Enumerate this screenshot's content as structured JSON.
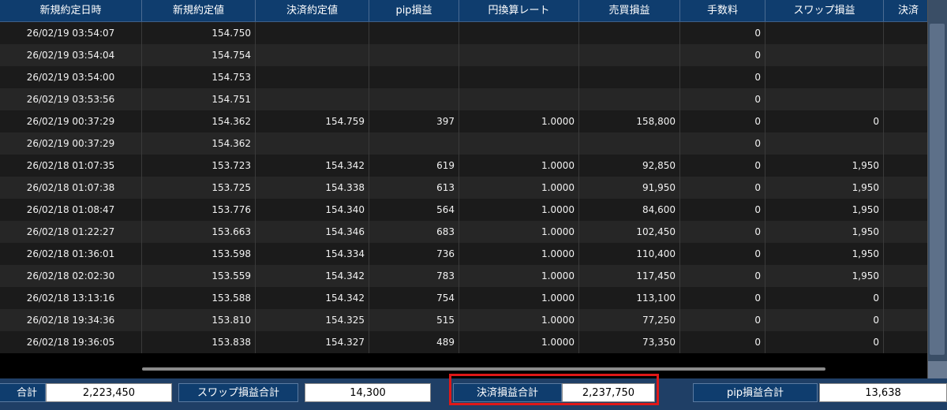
{
  "columns": [
    "新規約定日時",
    "新規約定値",
    "決済約定値",
    "pip損益",
    "円換算レート",
    "売買損益",
    "手数料",
    "スワップ損益",
    "決済"
  ],
  "rows": [
    {
      "date": "26/02/19 03:54:07",
      "open": "154.750",
      "close": "",
      "pip": "",
      "rate": "",
      "pl": "",
      "fee": "0",
      "swap": ""
    },
    {
      "date": "26/02/19 03:54:04",
      "open": "154.754",
      "close": "",
      "pip": "",
      "rate": "",
      "pl": "",
      "fee": "0",
      "swap": ""
    },
    {
      "date": "26/02/19 03:54:00",
      "open": "154.753",
      "close": "",
      "pip": "",
      "rate": "",
      "pl": "",
      "fee": "0",
      "swap": ""
    },
    {
      "date": "26/02/19 03:53:56",
      "open": "154.751",
      "close": "",
      "pip": "",
      "rate": "",
      "pl": "",
      "fee": "0",
      "swap": ""
    },
    {
      "date": "26/02/19 00:37:29",
      "open": "154.362",
      "close": "154.759",
      "pip": "397",
      "rate": "1.0000",
      "pl": "158,800",
      "fee": "0",
      "swap": "0"
    },
    {
      "date": "26/02/19 00:37:29",
      "open": "154.362",
      "close": "",
      "pip": "",
      "rate": "",
      "pl": "",
      "fee": "0",
      "swap": ""
    },
    {
      "date": "26/02/18 01:07:35",
      "open": "153.723",
      "close": "154.342",
      "pip": "619",
      "rate": "1.0000",
      "pl": "92,850",
      "fee": "0",
      "swap": "1,950"
    },
    {
      "date": "26/02/18 01:07:38",
      "open": "153.725",
      "close": "154.338",
      "pip": "613",
      "rate": "1.0000",
      "pl": "91,950",
      "fee": "0",
      "swap": "1,950"
    },
    {
      "date": "26/02/18 01:08:47",
      "open": "153.776",
      "close": "154.340",
      "pip": "564",
      "rate": "1.0000",
      "pl": "84,600",
      "fee": "0",
      "swap": "1,950"
    },
    {
      "date": "26/02/18 01:22:27",
      "open": "153.663",
      "close": "154.346",
      "pip": "683",
      "rate": "1.0000",
      "pl": "102,450",
      "fee": "0",
      "swap": "1,950"
    },
    {
      "date": "26/02/18 01:36:01",
      "open": "153.598",
      "close": "154.334",
      "pip": "736",
      "rate": "1.0000",
      "pl": "110,400",
      "fee": "0",
      "swap": "1,950"
    },
    {
      "date": "26/02/18 02:02:30",
      "open": "153.559",
      "close": "154.342",
      "pip": "783",
      "rate": "1.0000",
      "pl": "117,450",
      "fee": "0",
      "swap": "1,950"
    },
    {
      "date": "26/02/18 13:13:16",
      "open": "153.588",
      "close": "154.342",
      "pip": "754",
      "rate": "1.0000",
      "pl": "113,100",
      "fee": "0",
      "swap": "0"
    },
    {
      "date": "26/02/18 19:34:36",
      "open": "153.810",
      "close": "154.325",
      "pip": "515",
      "rate": "1.0000",
      "pl": "77,250",
      "fee": "0",
      "swap": "0"
    },
    {
      "date": "26/02/18 19:36:05",
      "open": "153.838",
      "close": "154.327",
      "pip": "489",
      "rate": "1.0000",
      "pl": "73,350",
      "fee": "0",
      "swap": "0"
    }
  ],
  "footer": {
    "first_label": "合計",
    "first_value": "2,223,450",
    "swap_total_label": "スワップ損益合計",
    "swap_total_value": "14,300",
    "settle_total_label": "決済損益合計",
    "settle_total_value": "2,237,750",
    "pip_total_label": "pip損益合計",
    "pip_total_value": "13,638"
  },
  "colors": {
    "highlight": "#e01818",
    "header": "#0f3d6e"
  }
}
